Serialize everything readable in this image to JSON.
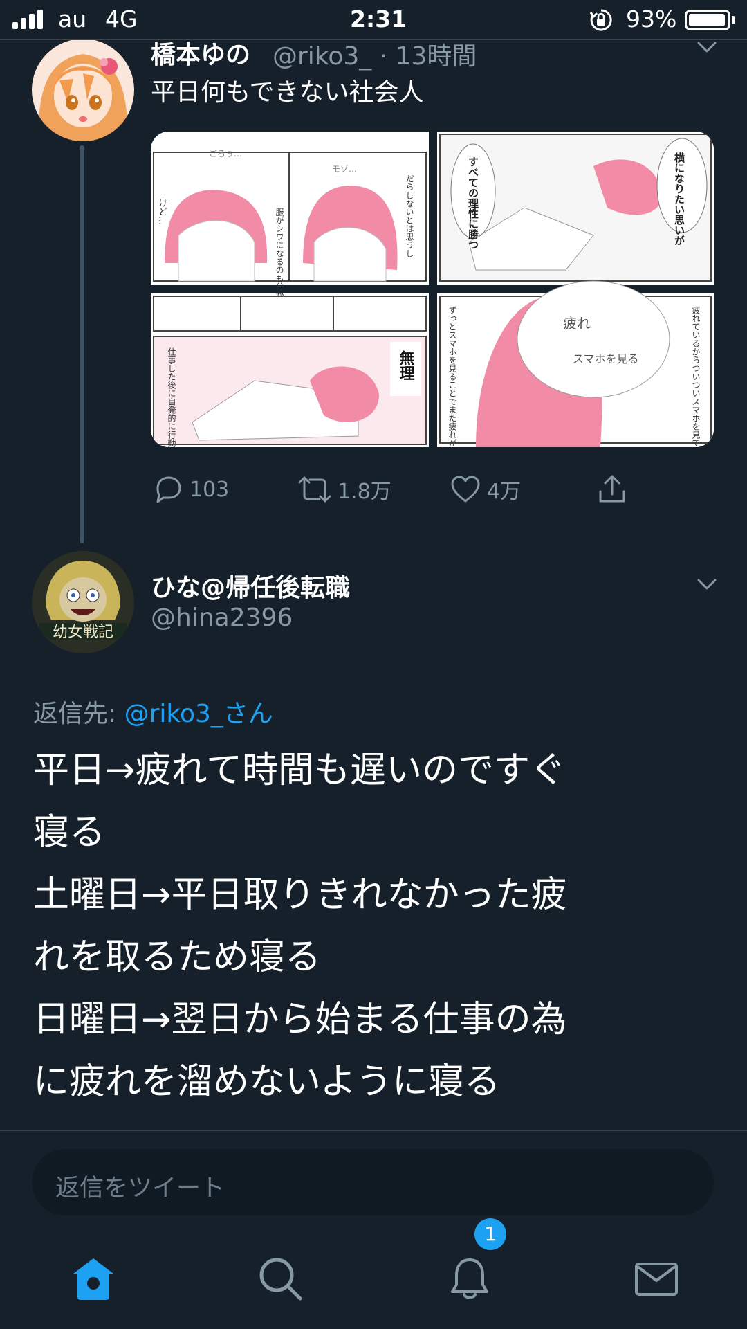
{
  "status_bar": {
    "carrier": "au",
    "network": "4G",
    "time": "2:31",
    "battery": "93%"
  },
  "thread": {
    "tweet1": {
      "display_name": "橋本ゆの",
      "handle_time": "@riko3_ · 13時間",
      "text": "平日何もできない社会人",
      "manga_text": {
        "p1_sfx": "ごろぅ…",
        "p1_side": "けど…",
        "p2_sfx": "モゾ…",
        "p2_caption": "服がシワになるのも分かってる",
        "p2_side": "だらしないとは思うし",
        "p3_bubble": "横になりたい思いが",
        "p3_caption": "すべての理性に勝つ",
        "p4_caption": "仕事した後に自発的に行動するなんて絶対無理",
        "p4_sfx": "無理",
        "p5_caption": "ずっとスマホを見ることでまた疲れが溜まってしまう…",
        "p5_side": "疲れているからついついスマホを見てしまい",
        "p5_bubble_1": "疲れ",
        "p5_bubble_2": "スマホを見る"
      },
      "actions": {
        "reply_count": "103",
        "retweet_count": "1.8万",
        "like_count": "4万"
      }
    },
    "tweet2": {
      "display_name": "ひな@帰任後転職",
      "handle": "@hina2396",
      "avatar_text": "幼女戦記",
      "reply_to_label": "返信先: ",
      "reply_to_mention": "@riko3_さん",
      "lines": [
        "平日→疲れて時間も遅いのですぐ",
        "寝る",
        "土曜日→平日取りきれなかった疲",
        "れを取るため寝る",
        "日曜日→翌日から始まる仕事の為",
        "に疲れを溜めないように寝る"
      ]
    }
  },
  "reply_box": {
    "placeholder": "返信をツイート"
  },
  "tab_bar": {
    "notification_badge": "1"
  },
  "colors": {
    "background": "#15202b",
    "accent": "#1da1f2",
    "secondary_text": "#8899a6"
  }
}
